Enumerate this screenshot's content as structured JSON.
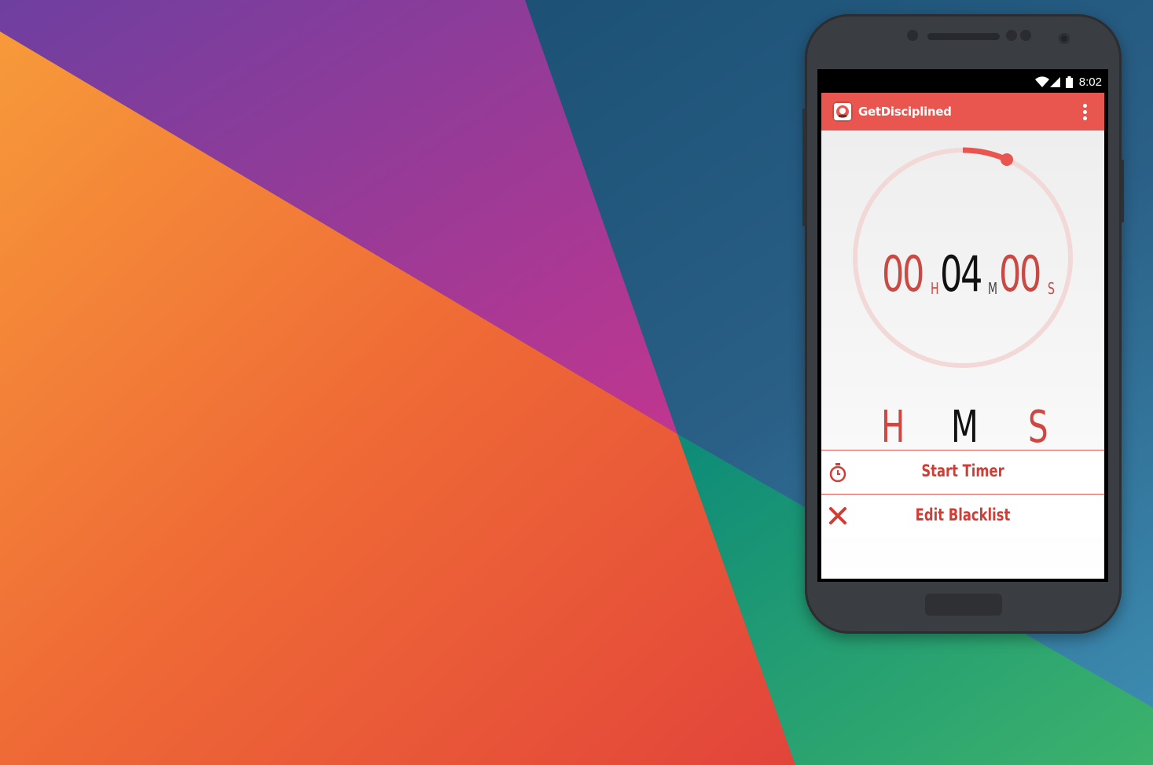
{
  "statusbar": {
    "time": "8:02"
  },
  "actionbar": {
    "title": "GetDisciplined",
    "app_icon": "app-logo-icon",
    "menu_icon": "overflow-menu-icon"
  },
  "timer": {
    "hours": "00",
    "minutes": "04",
    "seconds": "00",
    "hours_unit": "H",
    "minutes_unit": "M",
    "seconds_unit": "S",
    "progress": 0.067
  },
  "unit_selector": [
    "H",
    "M",
    "S"
  ],
  "selected_unit": "M",
  "menu": [
    {
      "label": "Start Timer",
      "icon": "stopwatch-icon"
    },
    {
      "label": "Edit Blacklist",
      "icon": "close-icon"
    }
  ],
  "colors": {
    "accent": "#e9564f",
    "text_accent": "#d33c35",
    "ring_track": "#f2d9d8",
    "active_text": "#111111"
  }
}
